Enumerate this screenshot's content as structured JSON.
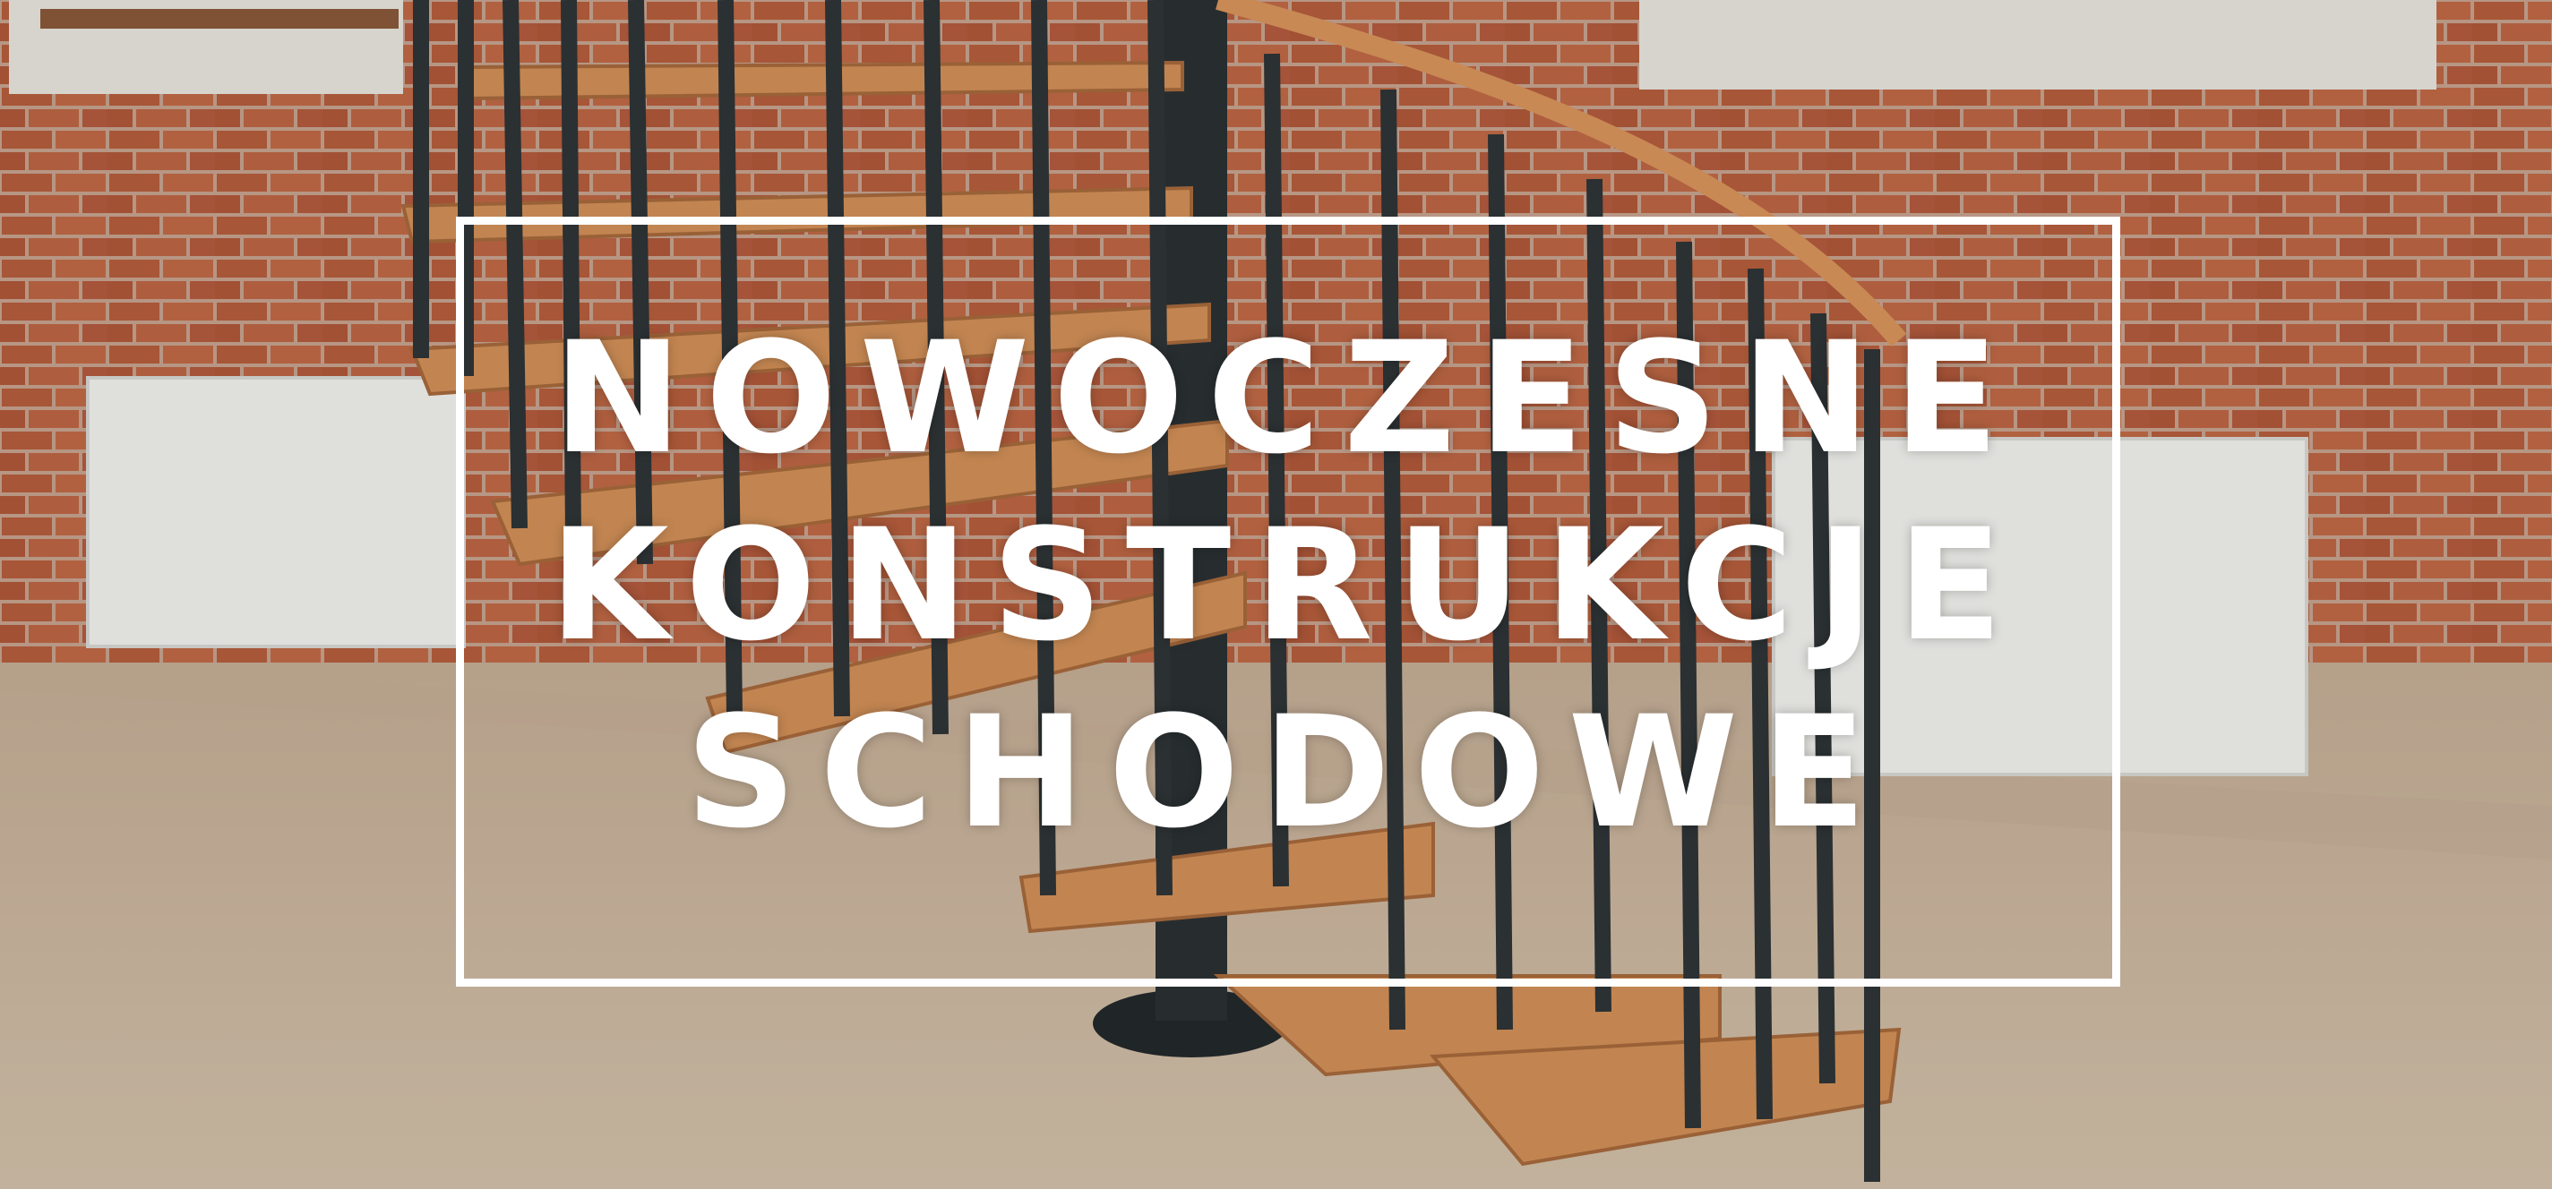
{
  "banner": {
    "lines": [
      "NOWOCZESNE",
      "KONSTRUKCJE",
      "SCHODOWE"
    ]
  },
  "colors": {
    "brick": "#b5603f",
    "mortar": "#c9a894",
    "floor": "#cdb9a1",
    "wood": "#d9955c",
    "metal": "#2f3537",
    "text": "#ffffff"
  }
}
